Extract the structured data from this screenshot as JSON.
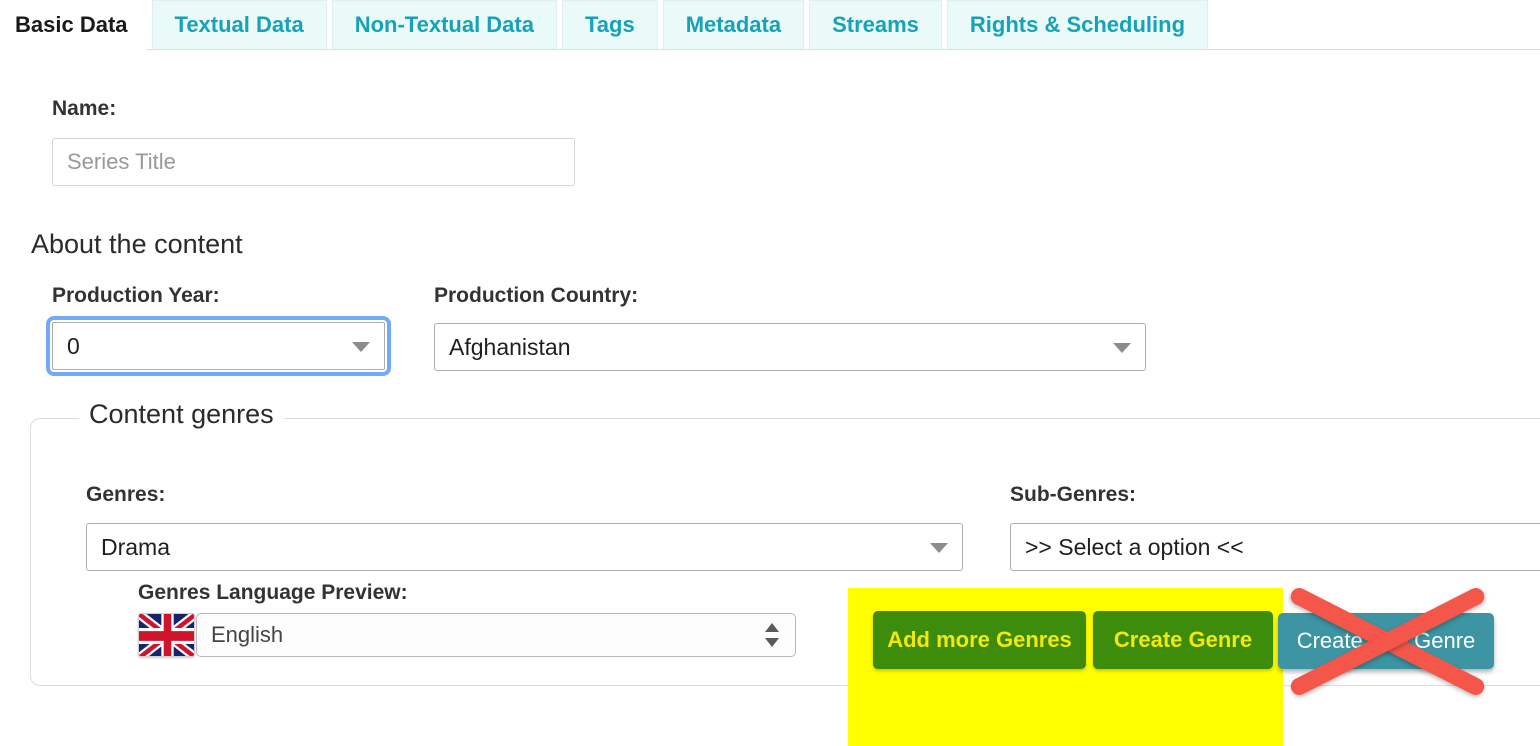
{
  "tabs": [
    {
      "label": "Basic Data",
      "active": true
    },
    {
      "label": "Textual Data",
      "active": false
    },
    {
      "label": "Non-Textual Data",
      "active": false
    },
    {
      "label": "Tags",
      "active": false
    },
    {
      "label": "Metadata",
      "active": false
    },
    {
      "label": "Streams",
      "active": false
    },
    {
      "label": "Rights & Scheduling",
      "active": false
    }
  ],
  "form": {
    "name_label": "Name:",
    "name_placeholder": "Series Title",
    "name_value": "",
    "about_section_title": "About the content",
    "production_year_label": "Production Year:",
    "production_year_value": "0",
    "production_country_label": "Production Country:",
    "production_country_value": "Afghanistan"
  },
  "content_genres": {
    "legend": "Content genres",
    "genres_label": "Genres:",
    "genres_value": "Drama",
    "sub_genres_label": "Sub-Genres:",
    "sub_genres_value": ">> Select a option <<",
    "language_preview_label": "Genres Language Preview:",
    "language_preview_value": "English",
    "language_flag": "uk-flag-icon",
    "buttons": {
      "add_more_genres": "Add more Genres",
      "create_genre": "Create Genre",
      "create_sub_genre": "Create Sub Genre"
    }
  },
  "annotations": {
    "highlight_color": "#ffff00",
    "strikeout_color": "#f4564a",
    "strikeout_target": "Create Sub Genre"
  },
  "colors": {
    "tab_text": "#17a2b8",
    "tab_bg": "#eafaf8",
    "green_button": "#3d8c0c",
    "green_button_text": "#f2e80a",
    "teal_button": "#3d94a3",
    "focus_ring": "#73aaf8"
  }
}
